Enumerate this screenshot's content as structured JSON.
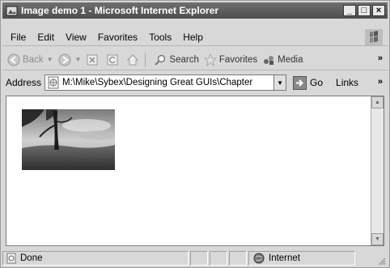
{
  "window": {
    "title": "Image demo 1 - Microsoft Internet Explorer"
  },
  "title_buttons": {
    "minimize": "_",
    "maximize": "□",
    "close": "×"
  },
  "menu": [
    "File",
    "Edit",
    "View",
    "Favorites",
    "Tools",
    "Help"
  ],
  "toolbar": {
    "back": "Back",
    "search": "Search",
    "favorites": "Favorites",
    "media": "Media",
    "overflow": "»"
  },
  "address_bar": {
    "label": "Address",
    "value": "M:\\Mike\\Sybex\\Designing Great GUIs\\Chapter",
    "go": "Go",
    "links": "Links",
    "overflow": "»"
  },
  "content": {
    "image_description_icon": "landscape-photo"
  },
  "status_bar": {
    "text": "Done",
    "zone": "Internet"
  },
  "colors": {
    "titlebar": "#5a5a5a",
    "chrome": "#d8d8d8",
    "content": "#ffffff"
  }
}
